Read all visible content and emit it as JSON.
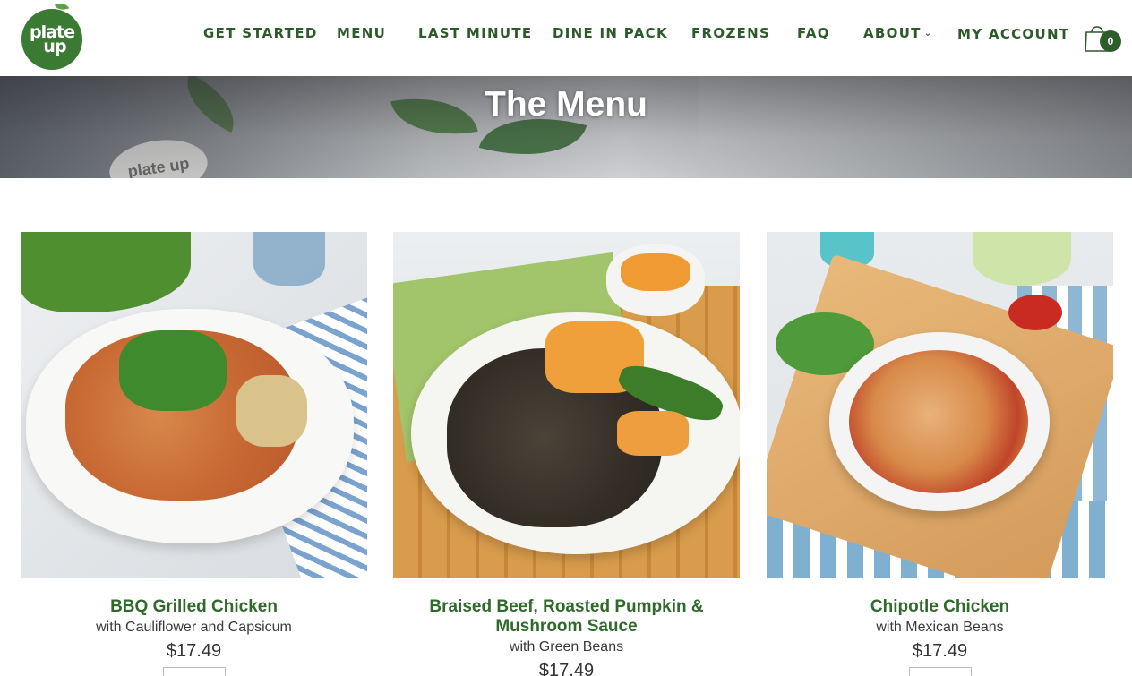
{
  "brand": {
    "logo_line1": "plate",
    "logo_line2": "up"
  },
  "nav": {
    "items": [
      "GET STARTED",
      "MENU",
      "LAST MINUTE",
      "DINE IN PACK",
      "FROZENS",
      "FAQ",
      "ABOUT"
    ],
    "account": "MY ACCOUNT",
    "cart_count": "0"
  },
  "hero": {
    "title": "The Menu",
    "plate_logo": "plate up"
  },
  "products": [
    {
      "name": "BBQ Grilled Chicken",
      "subtitle": "with Cauliflower and Capsicum",
      "price": "$17.49"
    },
    {
      "name": "Braised Beef, Roasted Pumpkin & Mushroom Sauce",
      "subtitle": "with Green Beans",
      "price": "$17.49"
    },
    {
      "name": "Chipotle Chicken",
      "subtitle": "with Mexican Beans",
      "price": "$17.49"
    }
  ],
  "colors": {
    "brand_green": "#3a7a33",
    "nav_text": "#2d5a2a",
    "title_green": "#2f6a2b"
  }
}
